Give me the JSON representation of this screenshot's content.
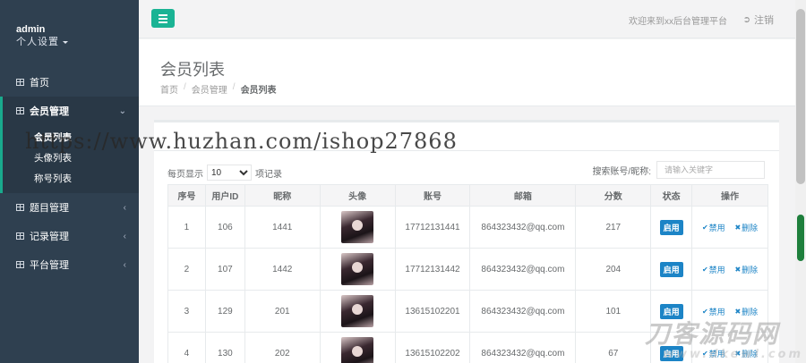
{
  "sidebar": {
    "username": "admin",
    "settings_label": "个人设置",
    "items": [
      {
        "label": "首页"
      },
      {
        "label": "会员管理",
        "submenu": [
          "会员列表",
          "头像列表",
          "称号列表"
        ]
      },
      {
        "label": "题目管理"
      },
      {
        "label": "记录管理"
      },
      {
        "label": "平台管理"
      }
    ]
  },
  "topbar": {
    "welcome": "欢迎来到xx后台管理平台",
    "logout": "注销"
  },
  "page": {
    "title": "会员列表",
    "breadcrumb": [
      "首页",
      "会员管理",
      "会员列表"
    ]
  },
  "toolbar": {
    "perpage_prefix": "每页显示",
    "perpage_value": "10",
    "perpage_suffix": "项记录",
    "search_label": "搜索账号/昵称:",
    "search_placeholder": "请输入关键字"
  },
  "table": {
    "headers": [
      "序号",
      "用户ID",
      "昵称",
      "头像",
      "账号",
      "邮箱",
      "分数",
      "状态",
      "操作"
    ],
    "rows": [
      {
        "idx": "1",
        "uid": "106",
        "nick": "1441",
        "account": "17712131441",
        "email": "864323432@qq.com",
        "score": "217",
        "status": "启用",
        "disable": "禁用",
        "delete": "删除"
      },
      {
        "idx": "2",
        "uid": "107",
        "nick": "1442",
        "account": "17712131442",
        "email": "864323432@qq.com",
        "score": "204",
        "status": "启用",
        "disable": "禁用",
        "delete": "删除"
      },
      {
        "idx": "3",
        "uid": "129",
        "nick": "201",
        "account": "13615102201",
        "email": "864323432@qq.com",
        "score": "101",
        "status": "启用",
        "disable": "禁用",
        "delete": "删除"
      },
      {
        "idx": "4",
        "uid": "130",
        "nick": "202",
        "account": "13615102202",
        "email": "864323432@qq.com",
        "score": "67",
        "status": "启用",
        "disable": "禁用",
        "delete": "删除"
      }
    ]
  },
  "watermarks": {
    "url": "https://www.huzhan.com/ishop27868",
    "logo": "刀客源码网",
    "logo_sub": "www.dkewl.com"
  },
  "colors": {
    "sidebar_bg": "#2f4050",
    "accent": "#1ab394",
    "badge": "#1c84c6"
  }
}
